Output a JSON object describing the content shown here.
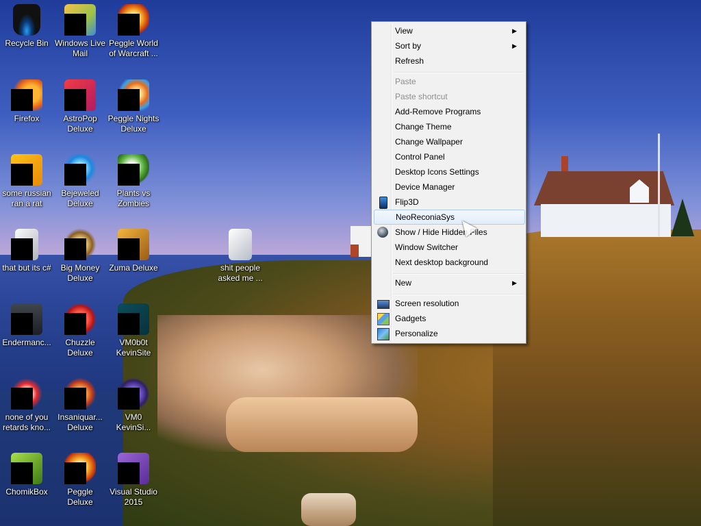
{
  "desktop": {
    "icons": [
      {
        "label": "Recycle Bin"
      },
      {
        "label": "Windows Live Mail"
      },
      {
        "label": "Peggle World of Warcraft ..."
      },
      {
        "label": "Firefox"
      },
      {
        "label": "AstroPop Deluxe"
      },
      {
        "label": "Peggle Nights Deluxe"
      },
      {
        "label": "some russian ran a rat"
      },
      {
        "label": "Bejeweled Deluxe"
      },
      {
        "label": "Plants vs Zombies"
      },
      {
        "label": "that but its c#"
      },
      {
        "label": "Big Money Deluxe"
      },
      {
        "label": "Zuma Deluxe"
      },
      {
        "label": "shit people asked me ..."
      },
      {
        "label": "Endermanc..."
      },
      {
        "label": "Chuzzle Deluxe"
      },
      {
        "label": "VM0b0t KevinSite"
      },
      {
        "label": "none of you retards kno..."
      },
      {
        "label": "Insaniquar... Deluxe"
      },
      {
        "label": "VM0 KevinSi..."
      },
      {
        "label": "ChomikBox"
      },
      {
        "label": "Peggle Deluxe"
      },
      {
        "label": "Visual Studio 2015"
      }
    ]
  },
  "context_menu": {
    "items": [
      {
        "label": "View",
        "submenu": true
      },
      {
        "label": "Sort by",
        "submenu": true
      },
      {
        "label": "Refresh"
      },
      {
        "label": "Paste",
        "disabled": true
      },
      {
        "label": "Paste shortcut",
        "disabled": true
      },
      {
        "label": "Add-Remove Programs"
      },
      {
        "label": "Change Theme"
      },
      {
        "label": "Change Wallpaper"
      },
      {
        "label": "Control Panel"
      },
      {
        "label": "Desktop Icons Settings"
      },
      {
        "label": "Device Manager"
      },
      {
        "label": "Flip3D",
        "icon": "flip3d-icon"
      },
      {
        "label": "NeoReconiaSys",
        "highlighted": true
      },
      {
        "label": "Show / Hide Hidden Files",
        "icon": "show-hide-icon"
      },
      {
        "label": "Window Switcher"
      },
      {
        "label": "Next desktop background"
      },
      {
        "label": "New",
        "submenu": true
      },
      {
        "label": "Screen resolution",
        "icon": "screen-resolution-icon"
      },
      {
        "label": "Gadgets",
        "icon": "gadgets-icon"
      },
      {
        "label": "Personalize",
        "icon": "personalize-icon"
      }
    ],
    "submenu_arrow": "▶"
  }
}
